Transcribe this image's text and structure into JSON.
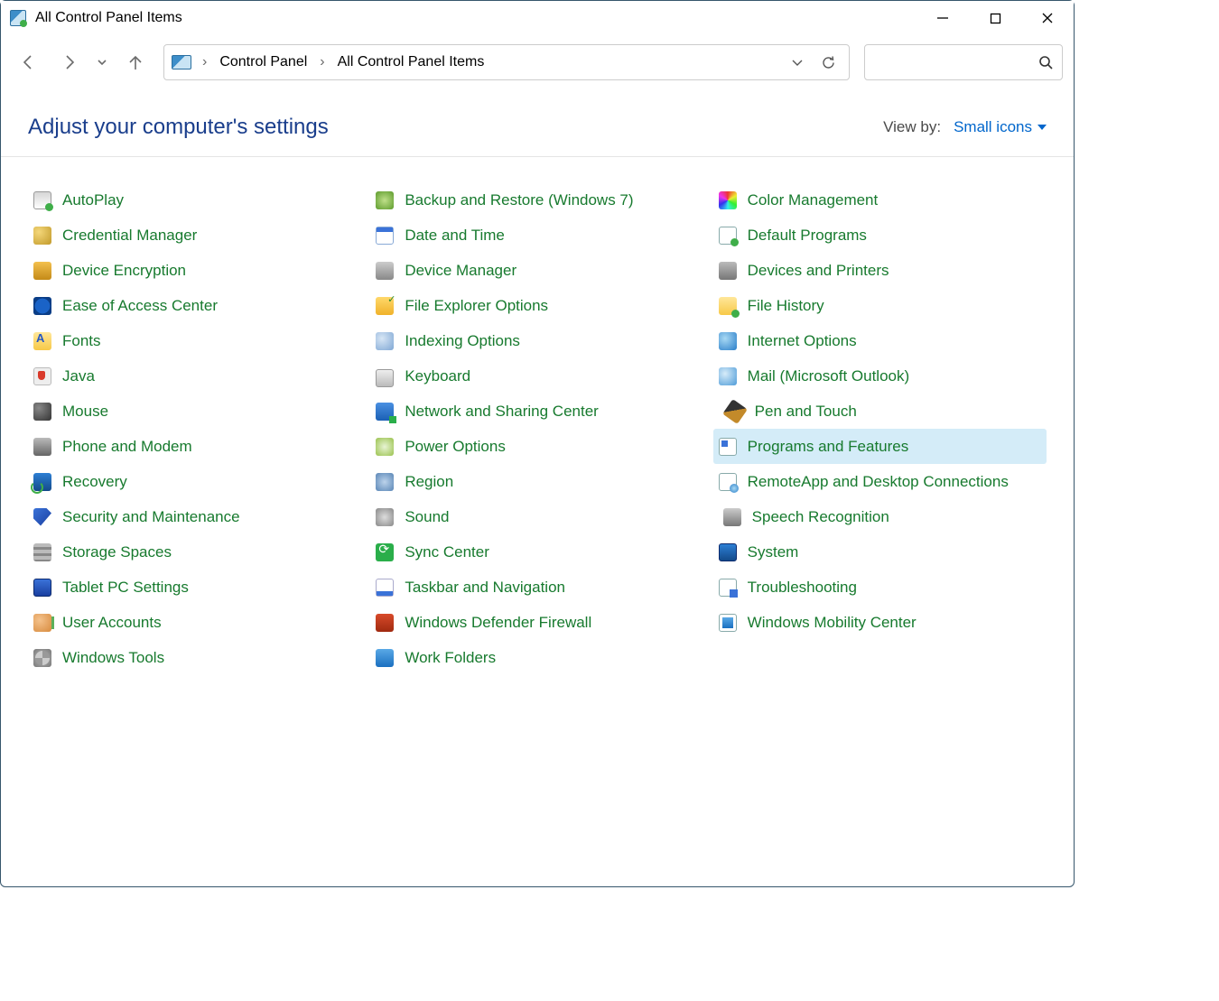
{
  "window": {
    "title": "All Control Panel Items"
  },
  "breadcrumb": {
    "root": "Control Panel",
    "current": "All Control Panel Items"
  },
  "heading": "Adjust your computer's settings",
  "viewby": {
    "label": "View by:",
    "value": "Small icons"
  },
  "selected_item": "Programs and Features",
  "items": [
    {
      "label": "AutoPlay",
      "icon": "autoplay"
    },
    {
      "label": "Credential Manager",
      "icon": "cred"
    },
    {
      "label": "Device Encryption",
      "icon": "devenc"
    },
    {
      "label": "Ease of Access Center",
      "icon": "ease"
    },
    {
      "label": "Fonts",
      "icon": "fonts"
    },
    {
      "label": "Java",
      "icon": "java"
    },
    {
      "label": "Mouse",
      "icon": "mouse"
    },
    {
      "label": "Phone and Modem",
      "icon": "phone"
    },
    {
      "label": "Recovery",
      "icon": "recovery"
    },
    {
      "label": "Security and Maintenance",
      "icon": "security"
    },
    {
      "label": "Storage Spaces",
      "icon": "storage"
    },
    {
      "label": "Tablet PC Settings",
      "icon": "tablet"
    },
    {
      "label": "User Accounts",
      "icon": "users"
    },
    {
      "label": "Windows Tools",
      "icon": "tools"
    },
    {
      "label": "Backup and Restore (Windows 7)",
      "icon": "backup"
    },
    {
      "label": "Date and Time",
      "icon": "date"
    },
    {
      "label": "Device Manager",
      "icon": "devmgr"
    },
    {
      "label": "File Explorer Options",
      "icon": "fileexp"
    },
    {
      "label": "Indexing Options",
      "icon": "indexing"
    },
    {
      "label": "Keyboard",
      "icon": "keyboard"
    },
    {
      "label": "Network and Sharing Center",
      "icon": "network"
    },
    {
      "label": "Power Options",
      "icon": "power"
    },
    {
      "label": "Region",
      "icon": "region"
    },
    {
      "label": "Sound",
      "icon": "sound"
    },
    {
      "label": "Sync Center",
      "icon": "sync"
    },
    {
      "label": "Taskbar and Navigation",
      "icon": "taskbar"
    },
    {
      "label": "Windows Defender Firewall",
      "icon": "firewall"
    },
    {
      "label": "Work Folders",
      "icon": "work"
    },
    {
      "label": "Color Management",
      "icon": "color"
    },
    {
      "label": "Default Programs",
      "icon": "defprog"
    },
    {
      "label": "Devices and Printers",
      "icon": "devprint"
    },
    {
      "label": "File History",
      "icon": "filehist"
    },
    {
      "label": "Internet Options",
      "icon": "internet"
    },
    {
      "label": "Mail (Microsoft Outlook)",
      "icon": "mail"
    },
    {
      "label": "Pen and Touch",
      "icon": "pen"
    },
    {
      "label": "Programs and Features",
      "icon": "programs"
    },
    {
      "label": "RemoteApp and Desktop Connections",
      "icon": "remote"
    },
    {
      "label": "Speech Recognition",
      "icon": "speech"
    },
    {
      "label": "System",
      "icon": "system"
    },
    {
      "label": "Troubleshooting",
      "icon": "trouble"
    },
    {
      "label": "Windows Mobility Center",
      "icon": "mobility"
    }
  ]
}
